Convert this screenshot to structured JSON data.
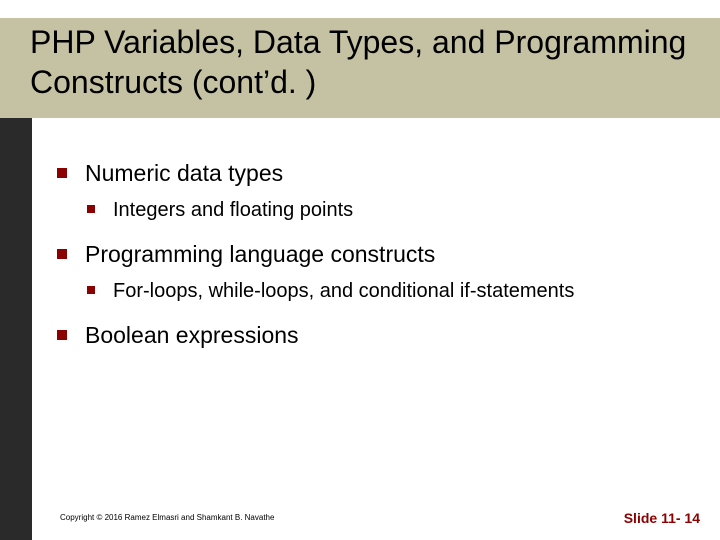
{
  "title": "PHP Variables, Data Types, and Programming Constructs (cont’d. )",
  "items": [
    {
      "text": "Numeric data types",
      "sub": [
        {
          "text": "Integers and floating points"
        }
      ]
    },
    {
      "text": "Programming language constructs",
      "sub": [
        {
          "text": "For-loops, while-loops, and conditional if-statements"
        }
      ]
    },
    {
      "text": "Boolean expressions",
      "sub": []
    }
  ],
  "footer": {
    "copyright": "Copyright © 2016 Ramez Elmasri and Shamkant B. Navathe",
    "slide_label": "Slide 11- 14"
  }
}
